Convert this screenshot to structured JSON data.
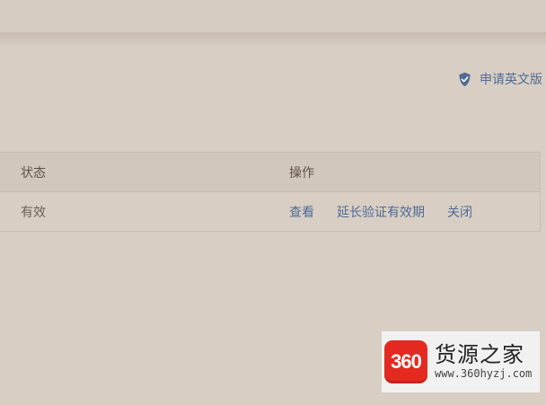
{
  "header": {
    "apply_english_label": "申请英文版"
  },
  "table": {
    "headers": {
      "status": "状态",
      "actions": "操作"
    },
    "rows": [
      {
        "status": "有效",
        "actions": {
          "view": "查看",
          "extend": "延长验证有效期",
          "close": "关闭"
        }
      }
    ]
  },
  "watermark": {
    "logo_text": "360",
    "title": "货源之家",
    "url": "www.360hyzj.com"
  },
  "icons": {
    "apply_english": "shield-icon"
  },
  "colors": {
    "background": "#d8cec4",
    "header_row": "#d2c7bc",
    "link": "#4e6b95",
    "watermark_red": "#e42a20"
  }
}
